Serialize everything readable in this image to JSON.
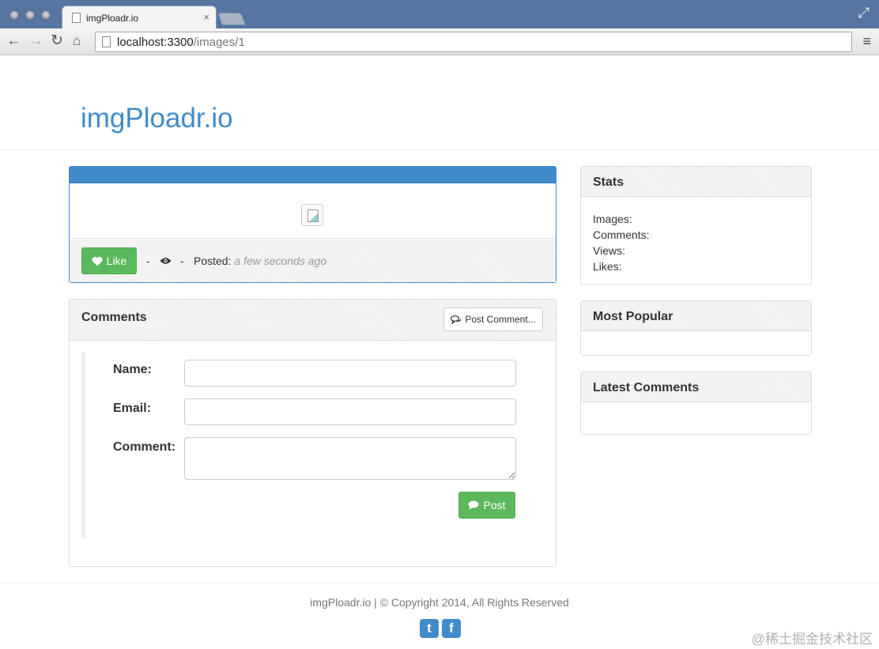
{
  "browser": {
    "tab_title": "imgPloadr.io",
    "tab_close": "×",
    "url_host": "localhost:3300",
    "url_path": "/images/1"
  },
  "site": {
    "brand": "imgPloadr.io"
  },
  "image_panel": {
    "like_label": "Like",
    "separator": "-",
    "posted_label": "Posted:",
    "posted_time": "a few seconds ago"
  },
  "comments": {
    "title": "Comments",
    "post_comment_label": "Post Comment...",
    "form": {
      "name_label": "Name:",
      "email_label": "Email:",
      "comment_label": "Comment:",
      "name_value": "",
      "email_value": "",
      "comment_value": "",
      "submit_label": "Post"
    }
  },
  "sidebar": {
    "stats_title": "Stats",
    "stats": {
      "images": "Images:",
      "comments": "Comments:",
      "views": "Views:",
      "likes": "Likes:"
    },
    "popular_title": "Most Popular",
    "latest_title": "Latest Comments"
  },
  "footer": {
    "copyright": "imgPloadr.io | © Copyright 2014, All Rights Reserved",
    "twitter_glyph": "t",
    "facebook_glyph": "f",
    "watermark": "@稀土掘金技术社区"
  },
  "icons": {
    "heart": "heart-icon",
    "eye": "eye-icon",
    "comment": "comment-icon",
    "comments": "comments-icon",
    "twitter": "twitter-icon",
    "facebook": "facebook-icon"
  },
  "colors": {
    "primary": "#428bca",
    "success": "#5cb85c",
    "chrome": "#5675a1"
  }
}
